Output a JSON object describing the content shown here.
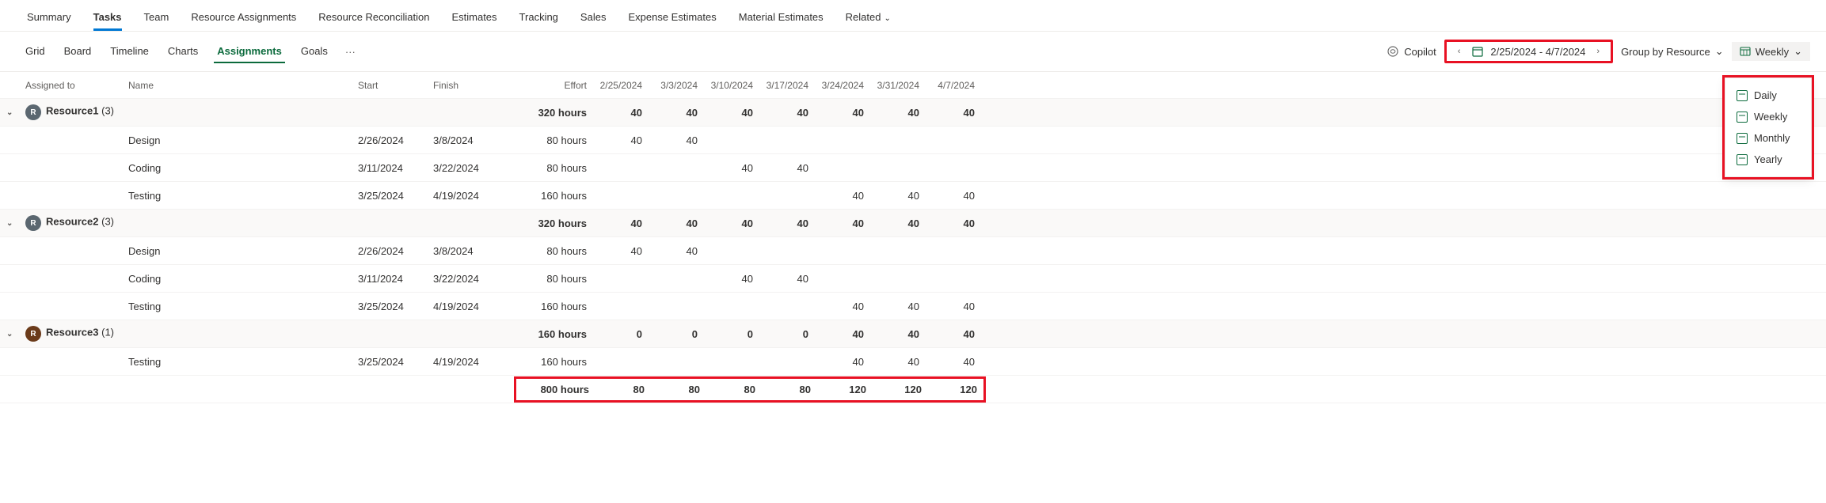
{
  "topTabs": [
    "Summary",
    "Tasks",
    "Team",
    "Resource Assignments",
    "Resource Reconciliation",
    "Estimates",
    "Tracking",
    "Sales",
    "Expense Estimates",
    "Material Estimates",
    "Related"
  ],
  "topActive": "Tasks",
  "subTabs": [
    "Grid",
    "Board",
    "Timeline",
    "Charts",
    "Assignments",
    "Goals"
  ],
  "subActive": "Assignments",
  "toolbar": {
    "copilot": "Copilot",
    "dateRange": "2/25/2024 - 4/7/2024",
    "groupBy": "Group by Resource",
    "timescale": "Weekly"
  },
  "timescaleOptions": [
    "Daily",
    "Weekly",
    "Monthly",
    "Yearly"
  ],
  "columns": {
    "assigned": "Assigned to",
    "name": "Name",
    "start": "Start",
    "finish": "Finish",
    "effort": "Effort"
  },
  "weekHeaders": [
    "2/25/2024",
    "3/3/2024",
    "3/10/2024",
    "3/17/2024",
    "3/24/2024",
    "3/31/2024",
    "4/7/2024"
  ],
  "groups": [
    {
      "label": "Resource1",
      "count": "(3)",
      "avatarColor": "#5b6770",
      "avatarLetter": "R",
      "effort": "320 hours",
      "weeks": [
        "40",
        "40",
        "40",
        "40",
        "40",
        "40",
        "40"
      ],
      "tasks": [
        {
          "name": "Design",
          "start": "2/26/2024",
          "finish": "3/8/2024",
          "effort": "80 hours",
          "weeks": [
            "40",
            "40",
            "",
            "",
            "",
            "",
            ""
          ]
        },
        {
          "name": "Coding",
          "start": "3/11/2024",
          "finish": "3/22/2024",
          "effort": "80 hours",
          "weeks": [
            "",
            "",
            "40",
            "40",
            "",
            "",
            ""
          ]
        },
        {
          "name": "Testing",
          "start": "3/25/2024",
          "finish": "4/19/2024",
          "effort": "160 hours",
          "weeks": [
            "",
            "",
            "",
            "",
            "40",
            "40",
            "40"
          ]
        }
      ]
    },
    {
      "label": "Resource2",
      "count": "(3)",
      "avatarColor": "#5b6770",
      "avatarLetter": "R",
      "effort": "320 hours",
      "weeks": [
        "40",
        "40",
        "40",
        "40",
        "40",
        "40",
        "40"
      ],
      "tasks": [
        {
          "name": "Design",
          "start": "2/26/2024",
          "finish": "3/8/2024",
          "effort": "80 hours",
          "weeks": [
            "40",
            "40",
            "",
            "",
            "",
            "",
            ""
          ]
        },
        {
          "name": "Coding",
          "start": "3/11/2024",
          "finish": "3/22/2024",
          "effort": "80 hours",
          "weeks": [
            "",
            "",
            "40",
            "40",
            "",
            "",
            ""
          ]
        },
        {
          "name": "Testing",
          "start": "3/25/2024",
          "finish": "4/19/2024",
          "effort": "160 hours",
          "weeks": [
            "",
            "",
            "",
            "",
            "40",
            "40",
            "40"
          ]
        }
      ]
    },
    {
      "label": "Resource3",
      "count": "(1)",
      "avatarColor": "#6b3b1a",
      "avatarLetter": "R",
      "effort": "160 hours",
      "weeks": [
        "0",
        "0",
        "0",
        "0",
        "40",
        "40",
        "40"
      ],
      "tasks": [
        {
          "name": "Testing",
          "start": "3/25/2024",
          "finish": "4/19/2024",
          "effort": "160 hours",
          "weeks": [
            "",
            "",
            "",
            "",
            "40",
            "40",
            "40"
          ]
        }
      ]
    }
  ],
  "total": {
    "effort": "800 hours",
    "weeks": [
      "80",
      "80",
      "80",
      "80",
      "120",
      "120",
      "120"
    ]
  }
}
